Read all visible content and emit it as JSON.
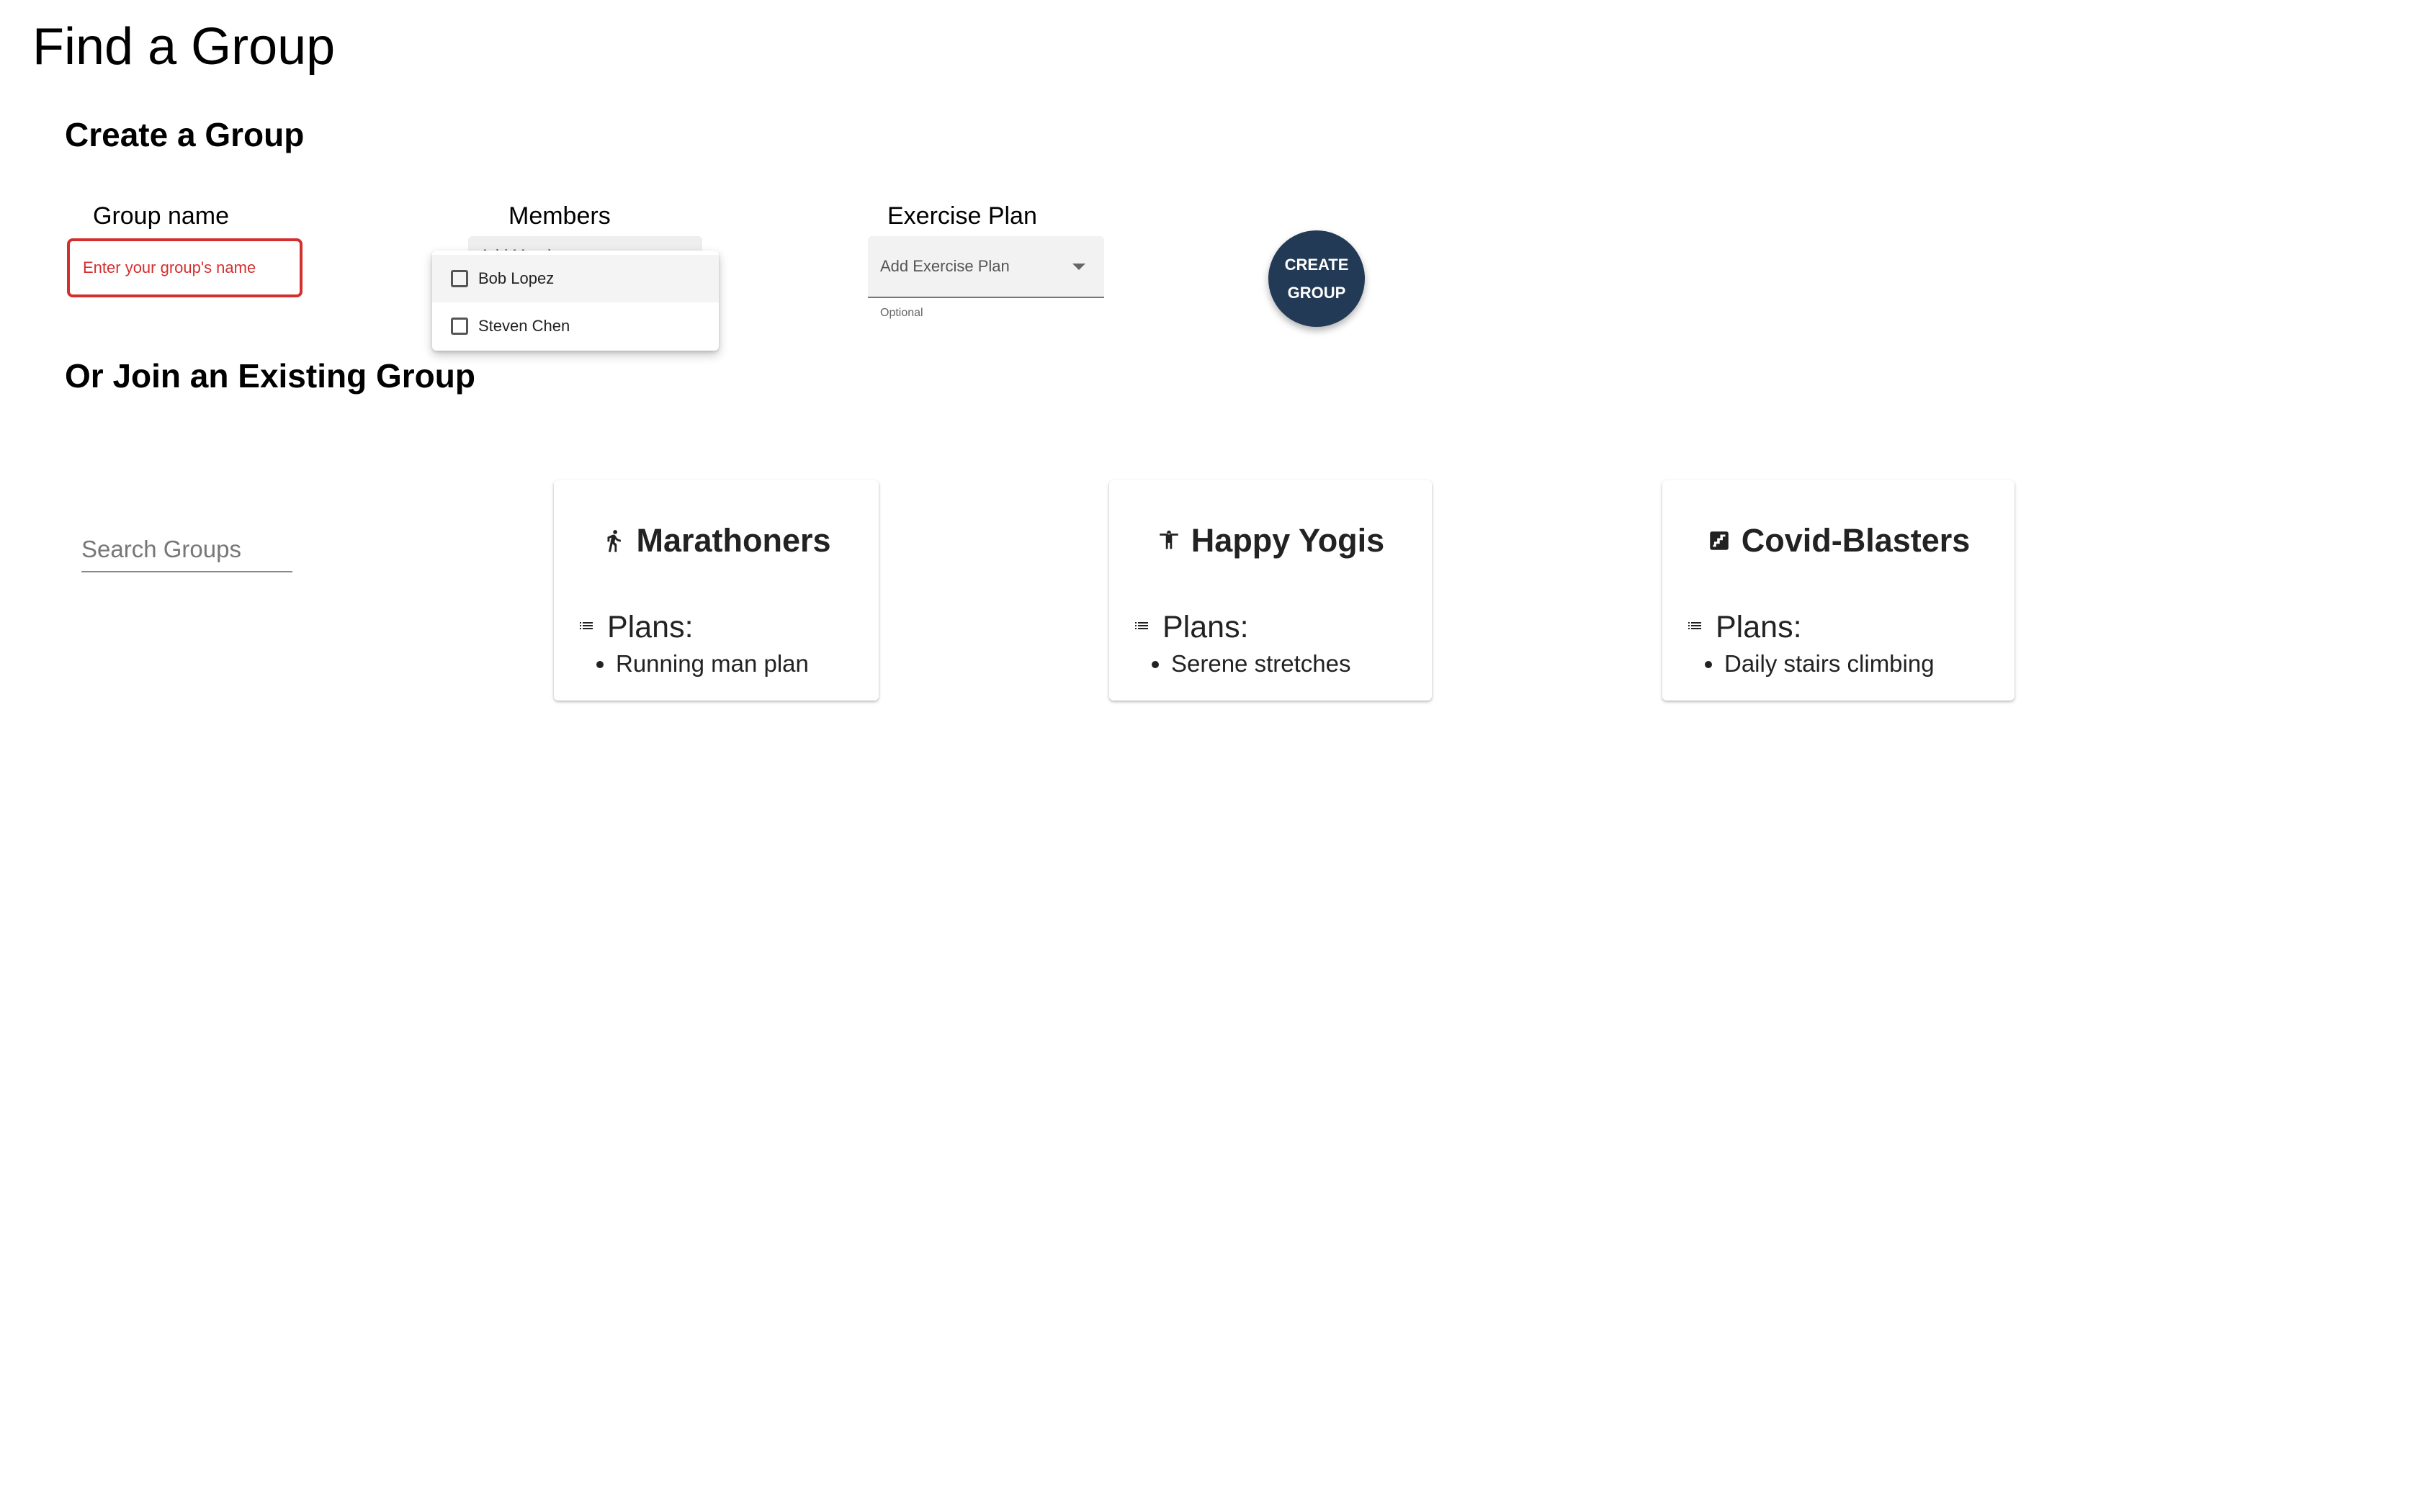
{
  "page": {
    "title": "Find a Group"
  },
  "create": {
    "heading": "Create a Group",
    "group_name": {
      "label": "Group name",
      "placeholder": "Enter your group's name",
      "value": ""
    },
    "members": {
      "label": "Members",
      "value": "Add Members",
      "options": [
        "Bob Lopez",
        "Steven Chen"
      ]
    },
    "exercise_plan": {
      "label": "Exercise Plan",
      "placeholder": "Add Exercise Plan",
      "helper": "Optional"
    },
    "button": {
      "line1": "CREATE",
      "line2": "GROUP",
      "color": "#223a55"
    }
  },
  "join": {
    "heading": "Or Join an Existing Group",
    "search": {
      "placeholder": "Search Groups",
      "value": ""
    },
    "groups": [
      {
        "name": "Marathoners",
        "icon": "running-icon",
        "plans_label": "Plans:",
        "plans": [
          "Running man plan"
        ]
      },
      {
        "name": "Happy Yogis",
        "icon": "yoga-icon",
        "plans_label": "Plans:",
        "plans": [
          "Serene stretches"
        ]
      },
      {
        "name": "Covid-Blasters",
        "icon": "stairs-icon",
        "plans_label": "Plans:",
        "plans": [
          "Daily stairs climbing"
        ]
      }
    ]
  },
  "colors": {
    "error": "#d32f2f",
    "accent": "#223a55"
  }
}
